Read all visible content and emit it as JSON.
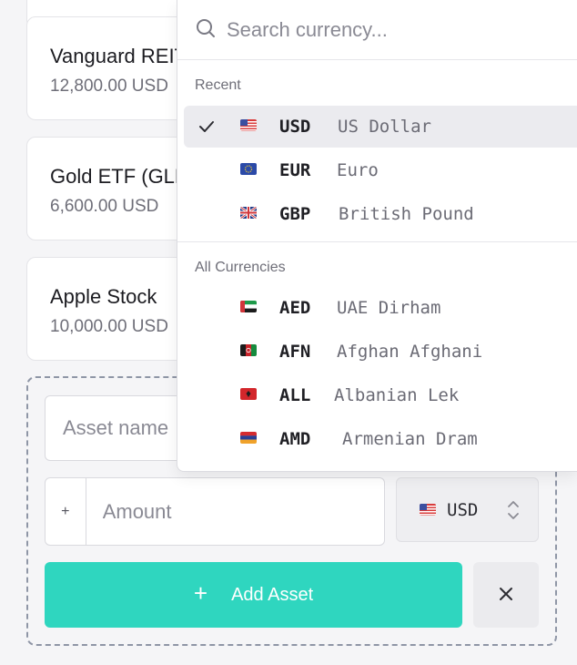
{
  "assets": [
    {
      "name": "Vanguard REIT ETF",
      "value": "12,800.00 USD"
    },
    {
      "name": "Gold ETF (GLD)",
      "value": "6,600.00 USD"
    },
    {
      "name": "Apple Stock",
      "value": "10,000.00 USD"
    }
  ],
  "form": {
    "asset_name_placeholder": "Asset name",
    "amount_prefix": "+",
    "amount_placeholder": "Amount",
    "currency_selected": "USD",
    "add_label": "Add Asset",
    "add_icon": "+"
  },
  "dropdown": {
    "search_placeholder": "Search currency...",
    "recent_label": "Recent",
    "all_label": "All Currencies",
    "recent": [
      {
        "code": "USD",
        "name": "US Dollar",
        "selected": true
      },
      {
        "code": "EUR",
        "name": "Euro",
        "selected": false
      },
      {
        "code": "GBP",
        "name": "British Pound",
        "selected": false
      }
    ],
    "all": [
      {
        "code": "AED",
        "name": "UAE Dirham"
      },
      {
        "code": "AFN",
        "name": "Afghan Afghani"
      },
      {
        "code": "ALL",
        "name": "Albanian Lek"
      },
      {
        "code": "AMD",
        "name": "Armenian Dram"
      }
    ]
  },
  "colors": {
    "accent": "#2fd6bf",
    "selected_row": "#ebebef",
    "dashed_border": "#8f96a6"
  },
  "icons": {
    "search": "search-icon",
    "check": "check-icon",
    "close": "close-icon",
    "chevrons": "chevron-up-down-icon"
  }
}
